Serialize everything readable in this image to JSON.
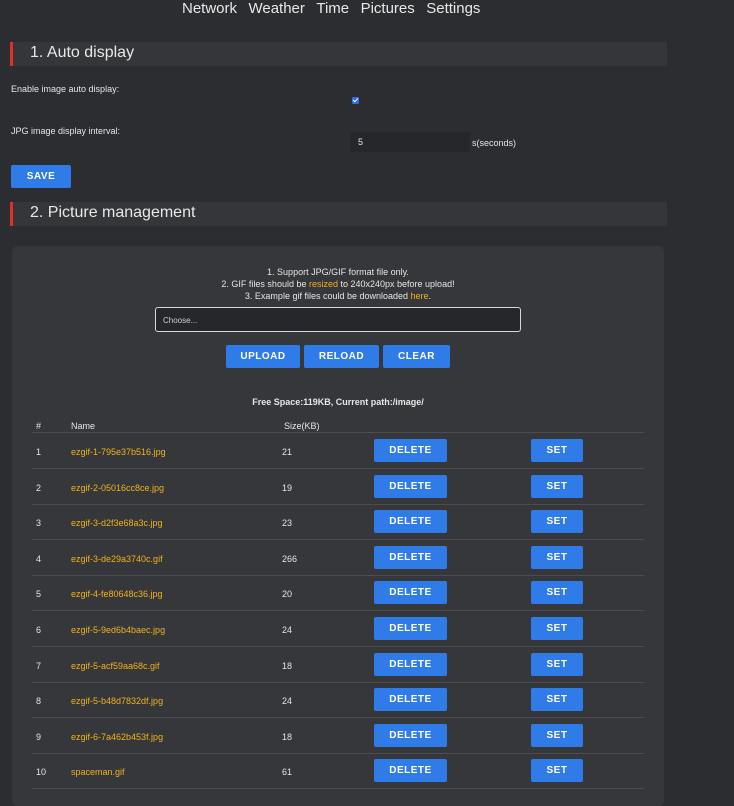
{
  "nav": {
    "items": [
      "Network",
      "Weather",
      "Time",
      "Pictures",
      "Settings"
    ]
  },
  "auto_display": {
    "title": "1. Auto display",
    "enable_label": "Enable image auto display:",
    "enabled": true,
    "interval_label": "JPG image display interval:",
    "interval_value": "5",
    "interval_unit": "s(seconds)",
    "save_label": "SAVE"
  },
  "picture_management": {
    "title": "2. Picture management",
    "info_line1": "1. Support JPG/GIF format file only.",
    "info_line2_a": "2. GIF files should be ",
    "info_line2_link": "resized",
    "info_line2_b": " to 240x240px before upload!",
    "info_line3_a": "3. Example gif files could be downloaded ",
    "info_line3_link": "here",
    "info_line3_b": ".",
    "file_placeholder": "Choose...",
    "upload_label": "UPLOAD",
    "reload_label": "RELOAD",
    "clear_label": "CLEAR",
    "free_space": "Free Space:119KB, Current path:/image/",
    "columns": [
      "#",
      "Name",
      "Size(KB)"
    ],
    "delete_label": "DELETE",
    "set_label": "SET",
    "files": [
      {
        "index": "1",
        "name": "ezgif-1-795e37b516.jpg",
        "size": "21"
      },
      {
        "index": "2",
        "name": "ezgif-2-05016cc8ce.jpg",
        "size": "19"
      },
      {
        "index": "3",
        "name": "ezgif-3-d2f3e68a3c.jpg",
        "size": "23"
      },
      {
        "index": "4",
        "name": "ezgif-3-de29a3740c.gif",
        "size": "266"
      },
      {
        "index": "5",
        "name": "ezgif-4-fe80648c36.jpg",
        "size": "20"
      },
      {
        "index": "6",
        "name": "ezgif-5-9ed6b4baec.jpg",
        "size": "24"
      },
      {
        "index": "7",
        "name": "ezgif-5-acf59aa68c.gif",
        "size": "18"
      },
      {
        "index": "8",
        "name": "ezgif-5-b48d7832df.jpg",
        "size": "24"
      },
      {
        "index": "9",
        "name": "ezgif-6-7a462b453f.jpg",
        "size": "18"
      },
      {
        "index": "10",
        "name": "spaceman.gif",
        "size": "61"
      }
    ]
  },
  "colors": {
    "accent_button": "#2f7be8",
    "section_bar": "#e0302a",
    "filename": "#f2b21b",
    "background": "#2b2d31"
  }
}
